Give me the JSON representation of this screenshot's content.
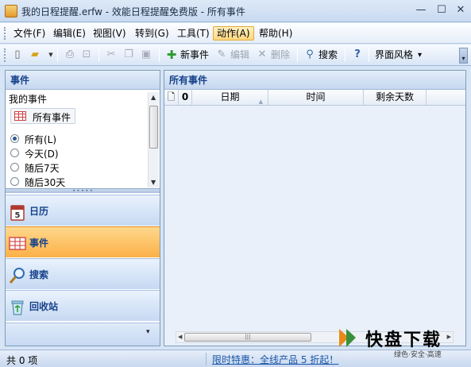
{
  "window": {
    "title": "我的日程提醒.erfw - 效能日程提醒免费版 - 所有事件",
    "minimize": "—",
    "maximize": "☐",
    "close": "✕"
  },
  "menubar": {
    "items": [
      {
        "label": "文件(F)"
      },
      {
        "label": "编辑(E)"
      },
      {
        "label": "视图(V)"
      },
      {
        "label": "转到(G)"
      },
      {
        "label": "工具(T)"
      },
      {
        "label": "动作(A)",
        "active": true
      },
      {
        "label": "帮助(H)"
      }
    ]
  },
  "toolbar": {
    "new_event": "新事件",
    "edit": "编辑",
    "delete": "删除",
    "search": "搜索",
    "ui_style": "界面风格",
    "ui_style_arrow": "▾"
  },
  "left_pane": {
    "header": "事件",
    "subheader": "我的事件",
    "all_events_button": "所有事件",
    "filters": [
      {
        "label": "所有(L)",
        "selected": true
      },
      {
        "label": "今天(D)",
        "selected": false
      },
      {
        "label": "随后7天",
        "selected": false
      },
      {
        "label": "随后30天",
        "selected": false
      }
    ],
    "nav": [
      {
        "label": "日历",
        "icon": "calendar-icon",
        "selected": false
      },
      {
        "label": "事件",
        "icon": "event-grid-icon",
        "selected": true
      },
      {
        "label": "搜索",
        "icon": "magnifier-icon",
        "selected": false
      },
      {
        "label": "回收站",
        "icon": "recycle-bin-icon",
        "selected": false
      }
    ],
    "calendar_badge": "5"
  },
  "right_pane": {
    "header": "所有事件",
    "columns": [
      "",
      "",
      "日期",
      "时间",
      "剩余天数"
    ],
    "rows": []
  },
  "statusbar": {
    "count": "共 0 项",
    "promo": "限时特惠：全线产品 5 折起！"
  },
  "watermark": {
    "logo_text": "快盘下载",
    "tagline": "绿色·安全·高速",
    "colors": {
      "accent": "#e88a1a"
    }
  },
  "colors": {
    "accent_orange": "#fbb047",
    "header_text": "#15428b",
    "link_blue": "#1a57a8"
  }
}
